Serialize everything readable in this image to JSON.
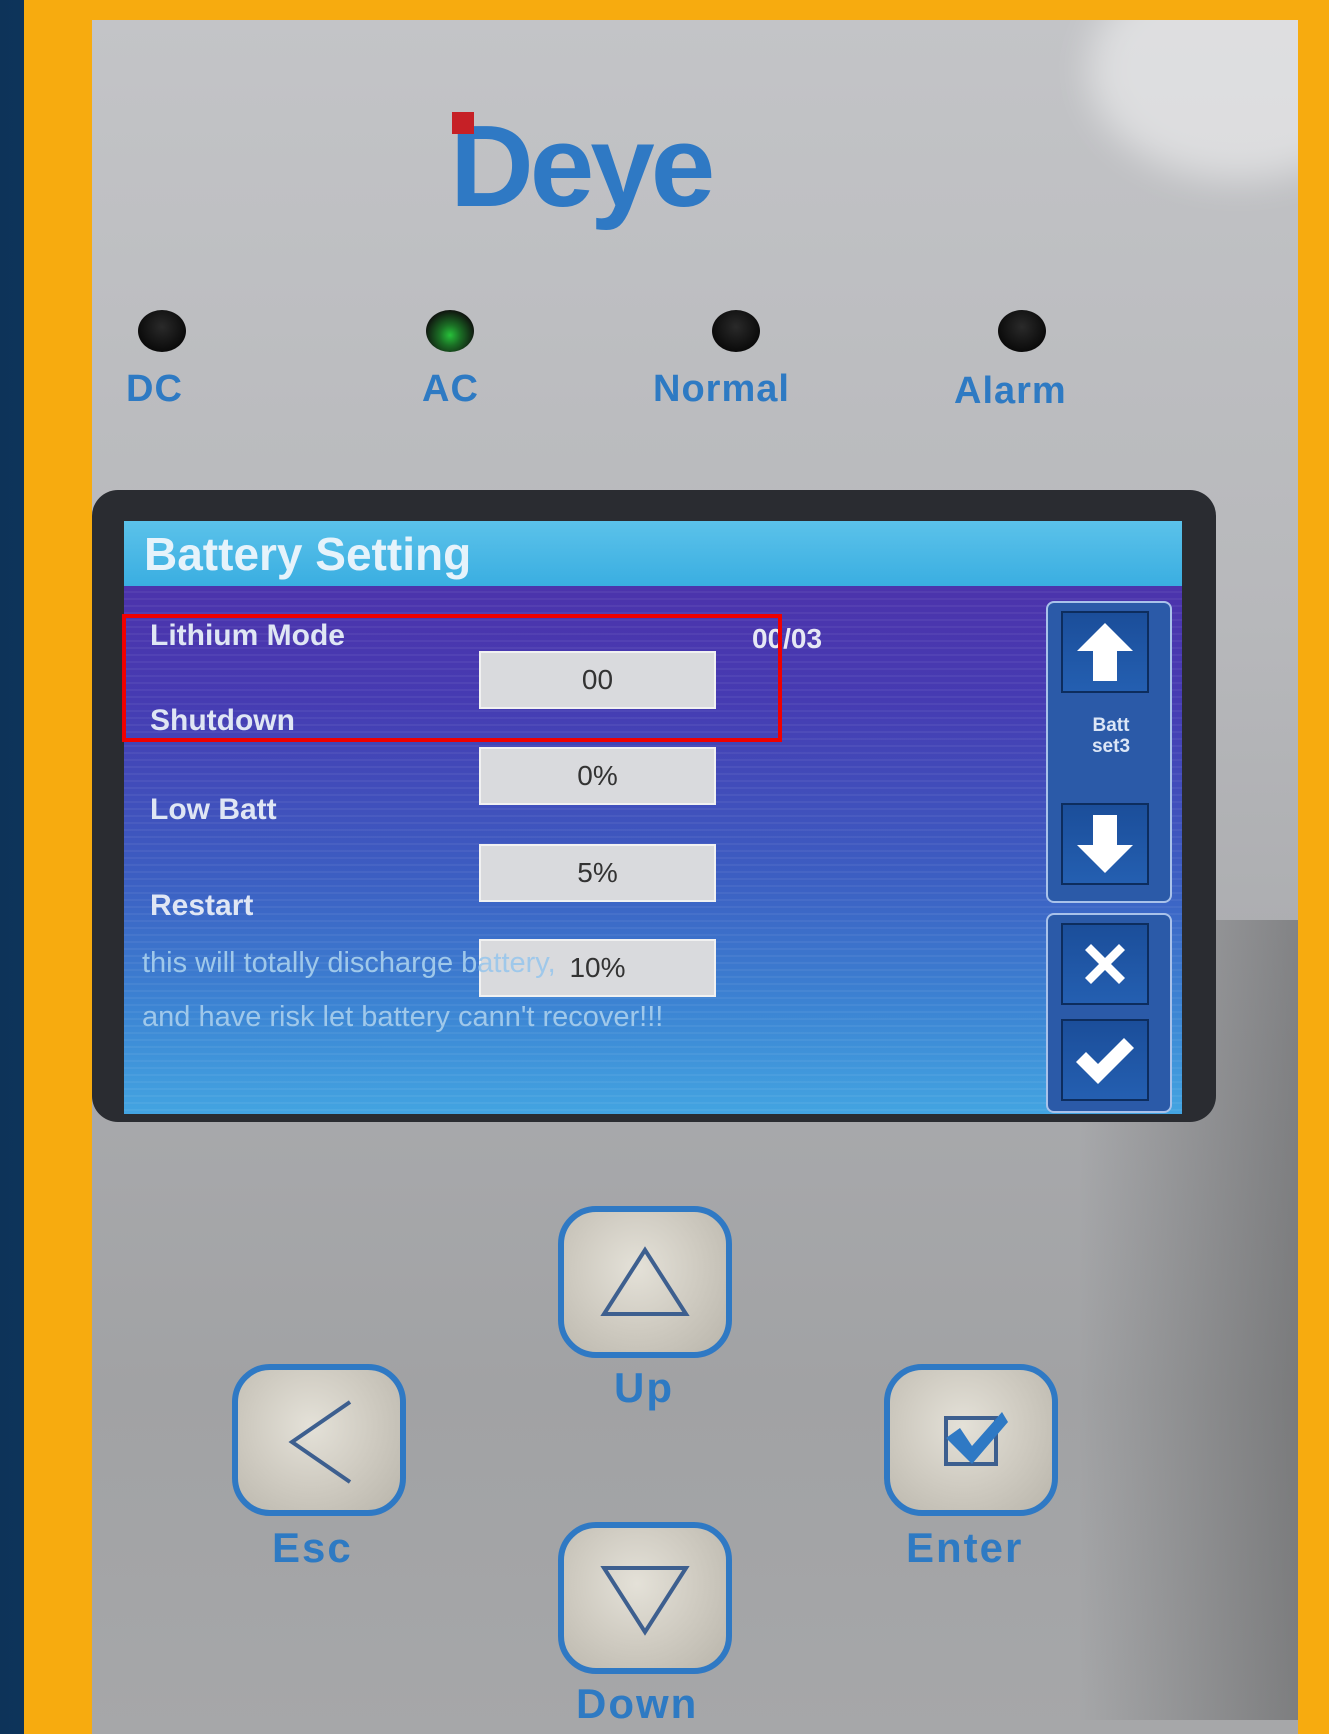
{
  "brand": {
    "logo_text": "Deye",
    "logo_mark_color": "#c62026",
    "logo_color": "#2f79c4"
  },
  "indicators": [
    {
      "label": "DC",
      "state": "off"
    },
    {
      "label": "AC",
      "state": "on",
      "color": "#27c13a"
    },
    {
      "label": "Normal",
      "state": "off"
    },
    {
      "label": "Alarm",
      "state": "off"
    }
  ],
  "screen": {
    "title": "Battery Setting",
    "rows": [
      {
        "label": "Lithium Mode",
        "value": "00"
      },
      {
        "label": "Shutdown",
        "value": "0%"
      },
      {
        "label": "Low Batt",
        "value": "5%"
      },
      {
        "label": "Restart",
        "value": "10%"
      }
    ],
    "mode_range": "00/03",
    "warning_line1": "this will totally discharge battery,",
    "warning_line2": "and have risk let battery cann't recover!!!",
    "side_label_line1": "Batt",
    "side_label_line2": "set3",
    "side_buttons": [
      "arrow-up-icon",
      "arrow-down-icon",
      "close-icon",
      "check-icon"
    ]
  },
  "highlight_color": "#ef0000",
  "keys": {
    "up": "Up",
    "esc": "Esc",
    "enter": "Enter",
    "down": "Down"
  },
  "colors": {
    "frame_orange": "#f7ab0f",
    "frame_navy": "#0f3a63",
    "label_blue": "#2e7ac3"
  }
}
